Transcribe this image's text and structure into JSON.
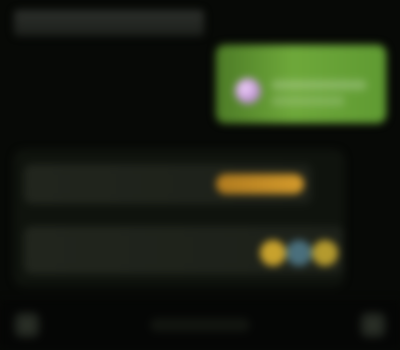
{
  "app": {
    "title": ""
  },
  "promo": {
    "primary_text": "",
    "secondary_text": ""
  },
  "panel": {
    "row1": {
      "label": "",
      "pill_label": ""
    },
    "row2": {
      "label": ""
    }
  },
  "bottom_bar": {
    "left_button_icon": "menu-icon",
    "right_button_icon": "settings-icon"
  },
  "colors": {
    "background": "#070906",
    "accent_green": "#6ea83a",
    "accent_orange": "#d39a2b",
    "accent_teal": "#4a6f7c"
  }
}
